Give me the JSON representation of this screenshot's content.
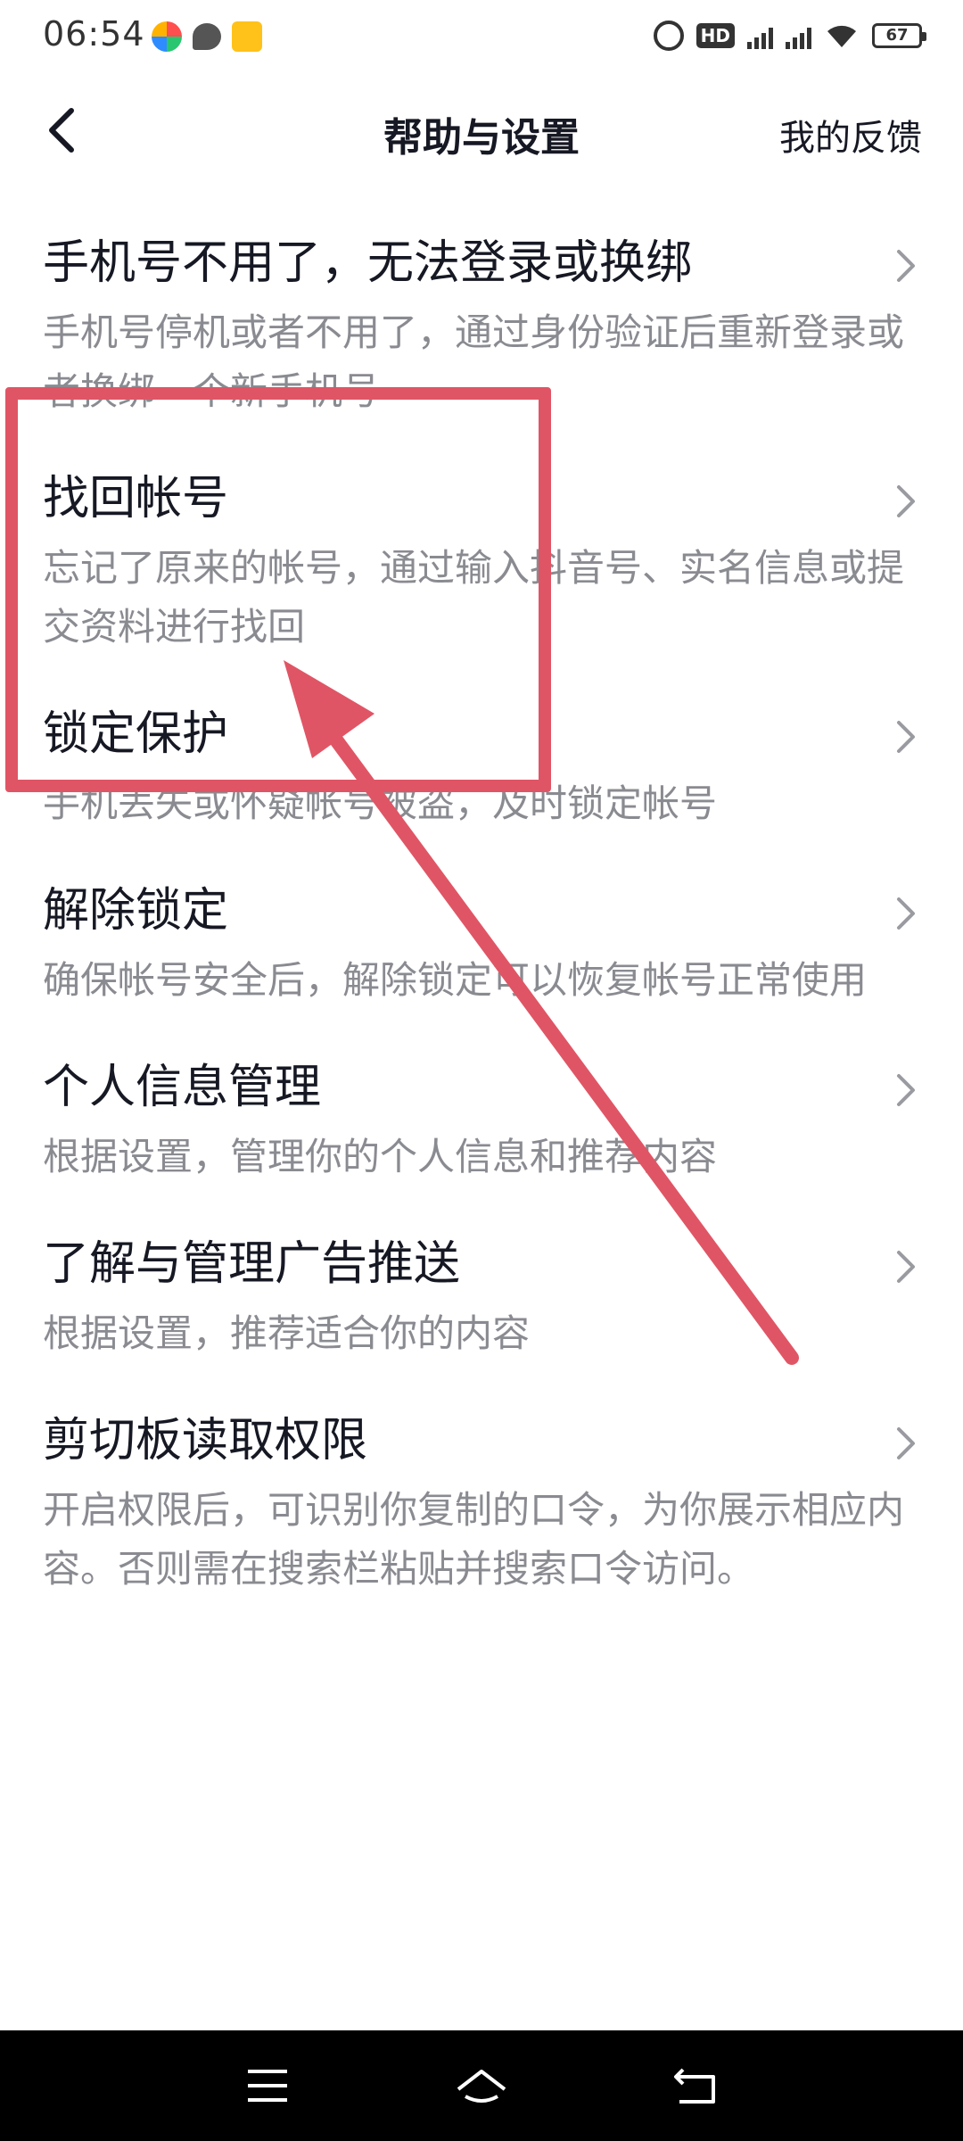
{
  "status_bar": {
    "time": "06:54",
    "hd_label": "HD",
    "battery": "67",
    "icons": [
      "swirl-app-icon",
      "chat-icon",
      "mail-icon",
      "alarm-icon",
      "hd-icon",
      "signal-icon",
      "wifi-icon",
      "battery-icon"
    ]
  },
  "header": {
    "title": "帮助与设置",
    "feedback_label": "我的反馈"
  },
  "items": [
    {
      "title": "手机号不用了，无法登录或换绑",
      "desc": "手机号停机或者不用了，通过身份验证后重新登录或者换绑一个新手机号"
    },
    {
      "title": "找回帐号",
      "desc": "忘记了原来的帐号，通过输入抖音号、实名信息或提交资料进行找回"
    },
    {
      "title": "锁定保护",
      "desc": "手机丢失或怀疑帐号被盗，及时锁定帐号"
    },
    {
      "title": "解除锁定",
      "desc": "确保帐号安全后，解除锁定可以恢复帐号正常使用"
    },
    {
      "title": "个人信息管理",
      "desc": "根据设置，管理你的个人信息和推荐内容"
    },
    {
      "title": "了解与管理广告推送",
      "desc": "根据设置，推荐适合你的内容"
    },
    {
      "title": "剪切板读取权限",
      "desc": "开启权限后，可识别你复制的口令，为你展示相应内容。否则需在搜索栏粘贴并搜索口令访问。"
    }
  ],
  "colors": {
    "annotation": "#e05565",
    "desc_text": "#8a8b91",
    "title_text": "#161823"
  }
}
